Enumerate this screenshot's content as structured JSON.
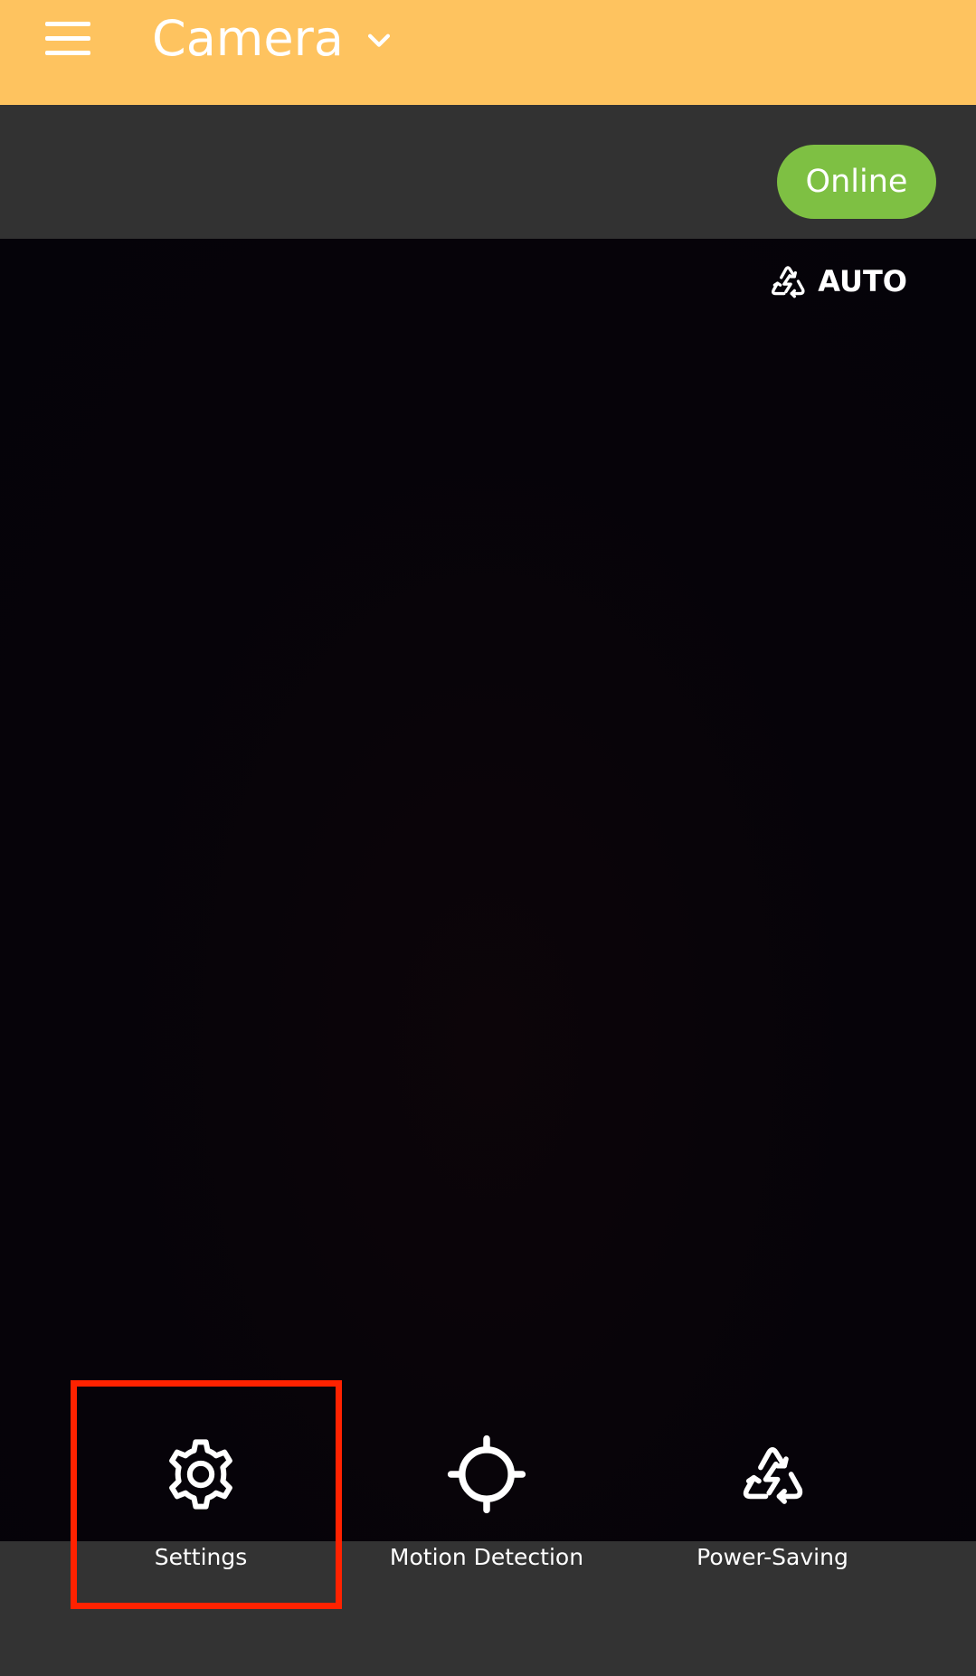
{
  "header": {
    "title": "Camera",
    "background": "#fec35f"
  },
  "status": {
    "online_label": "Online",
    "online_color": "#7ec043"
  },
  "video": {
    "mode_label": "AUTO",
    "mode_icon": "recycle-bolt-icon"
  },
  "actions": [
    {
      "label": "Settings",
      "icon": "gear-icon"
    },
    {
      "label": "Motion Detection",
      "icon": "crosshair-icon"
    },
    {
      "label": "Power-Saving",
      "icon": "recycle-bolt-icon"
    }
  ],
  "highlight_color": "#ff2200"
}
